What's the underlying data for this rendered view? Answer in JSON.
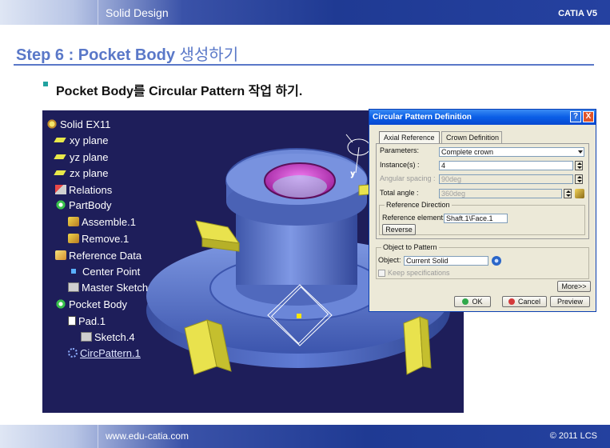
{
  "header": {
    "section": "Solid Design",
    "product": "CATIA V5"
  },
  "step": {
    "title_en": "Step 6 : Pocket Body",
    "title_ko": "생성하기"
  },
  "bullet": {
    "text": "Pocket Body를 Circular Pattern 작업 하기."
  },
  "tree": {
    "items": [
      {
        "label": "Solid EX11",
        "icon": "part-icon"
      },
      {
        "label": "xy plane",
        "icon": "plane-icon"
      },
      {
        "label": "yz plane",
        "icon": "plane-icon"
      },
      {
        "label": "zx plane",
        "icon": "plane-icon"
      },
      {
        "label": "Relations",
        "icon": "relations-icon"
      },
      {
        "label": "PartBody",
        "icon": "body-icon"
      },
      {
        "label": "Assemble.1",
        "icon": "assemble-icon"
      },
      {
        "label": "Remove.1",
        "icon": "remove-icon"
      },
      {
        "label": "Reference Data",
        "icon": "reference-data-icon"
      },
      {
        "label": "Center Point",
        "icon": "point-icon"
      },
      {
        "label": "Master Sketch",
        "icon": "sketch-icon"
      },
      {
        "label": "Pocket Body",
        "icon": "body-icon"
      },
      {
        "label": "Pad.1",
        "icon": "pad-icon"
      },
      {
        "label": "Sketch.4",
        "icon": "sketch-icon"
      },
      {
        "label": "CircPattern.1",
        "icon": "circular-pattern-icon"
      }
    ]
  },
  "dialog": {
    "title": "Circular Pattern Definition",
    "help": "?",
    "close": "X",
    "tabs": [
      "Axial Reference",
      "Crown Definition"
    ],
    "parameters_label": "Parameters:",
    "parameters_value": "Complete crown",
    "instances_label": "Instance(s) :",
    "instances_value": "4",
    "angular_spacing_label": "Angular spacing :",
    "angular_spacing_value": "90deg",
    "total_angle_label": "Total angle :",
    "total_angle_value": "360deg",
    "reference_direction_title": "Reference Direction",
    "reference_element_label": "Reference element:",
    "reference_element_value": "Shaft.1\\Face.1",
    "reverse_label": "Reverse",
    "object_to_pattern_title": "Object to Pattern",
    "object_label": "Object:",
    "object_value": "Current Solid",
    "keep_specifications_label": "Keep specifications",
    "more_label": "More>>",
    "ok_label": "OK",
    "cancel_label": "Cancel",
    "preview_label": "Preview"
  },
  "footer": {
    "url": "www.edu-catia.com",
    "copyright": "© 2011 LCS"
  },
  "colors": {
    "header_blue": "#1f3a93",
    "title_blue": "#5a78c8",
    "viewport_bg": "#1e1e5a",
    "part_blue": "#5b78cf",
    "pocket_magenta": "#c833c8",
    "tab_yellow": "#e6e04a",
    "dialog_bg": "#ece9d8",
    "dialog_title": "#0a5ee6"
  }
}
